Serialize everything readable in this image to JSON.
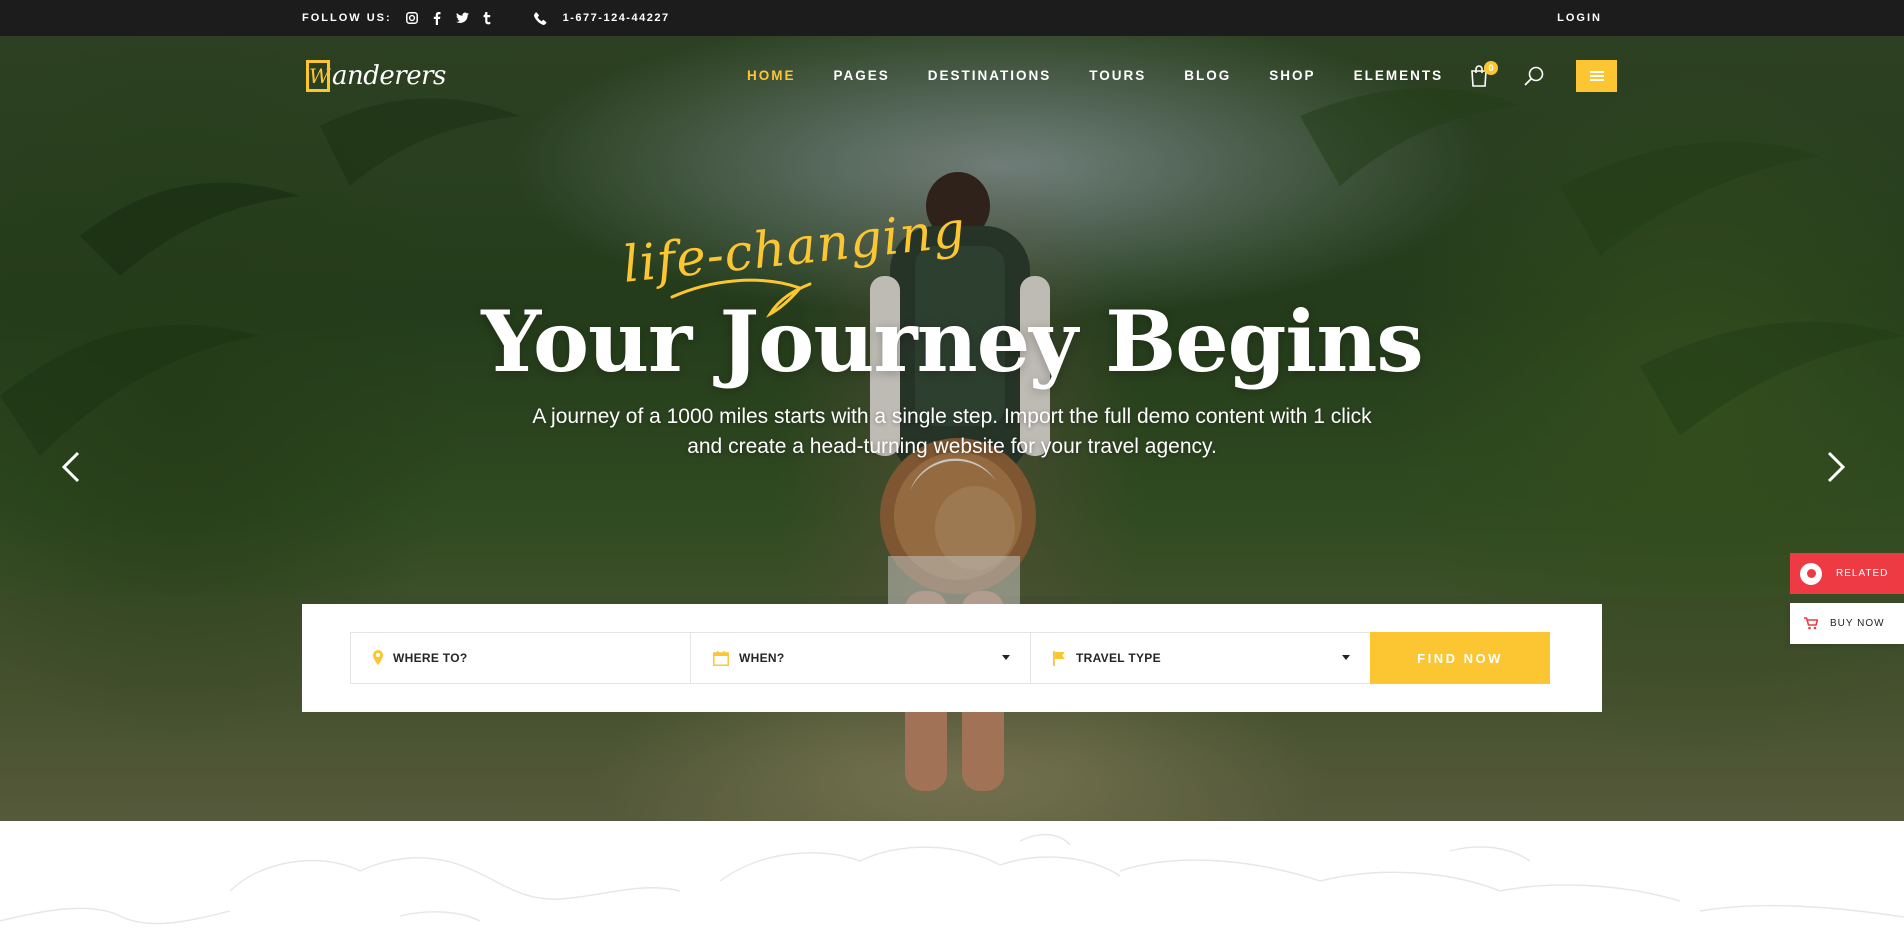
{
  "topbar": {
    "follow_label": "FOLLOW US:",
    "social_icons": [
      "instagram-icon",
      "facebook-icon",
      "twitter-icon",
      "tumblr-icon"
    ],
    "phone": "1-677-124-44227",
    "login": "LOGIN"
  },
  "header": {
    "logo_mark": "W",
    "logo_text": "anderers",
    "nav": [
      "HOME",
      "PAGES",
      "DESTINATIONS",
      "TOURS",
      "BLOG",
      "SHOP",
      "ELEMENTS"
    ],
    "active_nav": "HOME",
    "cart_count": "0"
  },
  "hero": {
    "script": "life-changing",
    "title": "Your Journey Begins",
    "subtitle_line1": "A journey of a 1000 miles starts with a single step. Import the full demo content with 1 click",
    "subtitle_line2": "and create a head-turning website for your travel agency."
  },
  "search_form": {
    "where_placeholder": "WHERE TO?",
    "when_label": "WHEN?",
    "travel_type_label": "TRAVEL TYPE",
    "button": "FIND NOW"
  },
  "side_widgets": {
    "related": "RELATED",
    "buy_now": "BUY NOW"
  },
  "colors": {
    "accent": "#fcc632",
    "topbar": "#1c1c1c",
    "related_red": "#ee3a43"
  }
}
